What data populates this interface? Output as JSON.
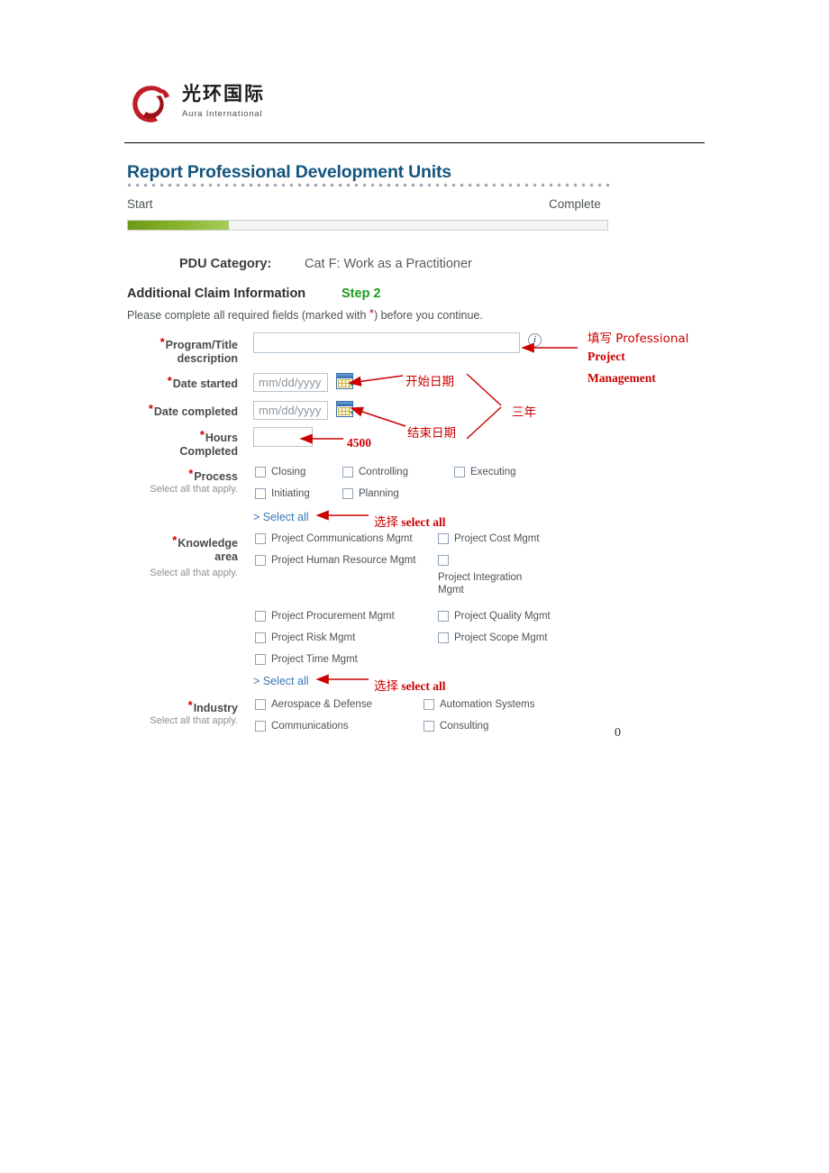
{
  "logo": {
    "zh_name": "光环国际",
    "en_name": "Aura  International",
    "mark": "red-swoosh-circle"
  },
  "header": {
    "title": "Report Professional Development Units",
    "progress_start_label": "Start",
    "progress_complete_label": "Complete",
    "progress_percent": 21
  },
  "pdu": {
    "category_label": "PDU Category:",
    "category_value": "Cat F: Work as a Practitioner"
  },
  "section": {
    "heading": "Additional Claim Information",
    "step": "Step 2",
    "required_note_before": "Please complete all required fields (marked with ",
    "required_note_after": ") before you continue."
  },
  "form": {
    "program_title": {
      "label_line1": "Program/Title",
      "label_line2": "description",
      "value": "",
      "placeholder": ""
    },
    "date_started": {
      "label": "Date started",
      "value": "",
      "placeholder": "mm/dd/yyyy"
    },
    "date_completed": {
      "label": "Date completed",
      "value": "",
      "placeholder": "mm/dd/yyyy"
    },
    "hours_completed": {
      "label_line1": "Hours",
      "label_line2": "Completed",
      "value": "",
      "placeholder": ""
    },
    "process": {
      "label": "Process",
      "sub_note": "Select all that apply.",
      "options": [
        "Closing",
        "Controlling",
        "Executing",
        "Initiating",
        "Planning"
      ],
      "select_all_label": "> Select all"
    },
    "knowledge_area": {
      "label_line1": "Knowledge",
      "label_line2": "area",
      "sub_note": "Select all that apply.",
      "options": [
        "Project Communications Mgmt",
        "Project Cost Mgmt",
        "Project Human Resource Mgmt",
        "Project Integration Mgmt",
        "Project Procurement Mgmt",
        "Project Quality Mgmt",
        "Project Risk Mgmt",
        "Project Scope Mgmt",
        "Project Time Mgmt"
      ],
      "select_all_label": "> Select all"
    },
    "industry": {
      "label": "Industry",
      "sub_note": "Select all that apply.",
      "options": [
        "Aerospace & Defense",
        "Automation Systems",
        "Communications",
        "Consulting"
      ]
    }
  },
  "annotations": {
    "program_title_note_line1": "填写 Professional",
    "program_title_note_line2": "Project",
    "program_title_note_line3": "Management",
    "date_started_note": "开始日期",
    "date_completed_note": "结束日期",
    "duration_note": "三年",
    "hours_note": "4500",
    "process_select_all_note_zh": "选择",
    "process_select_all_note_en": "select all",
    "knowledge_select_all_note_zh": "选择",
    "knowledge_select_all_note_en": "select all"
  },
  "footer": {
    "page_number": "0"
  },
  "colors": {
    "title_blue": "#15557f",
    "step_green": "#1c9c1c",
    "annotation_red": "#cc0000",
    "link_blue": "#3a77b5",
    "progress_green": "#8ab62e"
  }
}
